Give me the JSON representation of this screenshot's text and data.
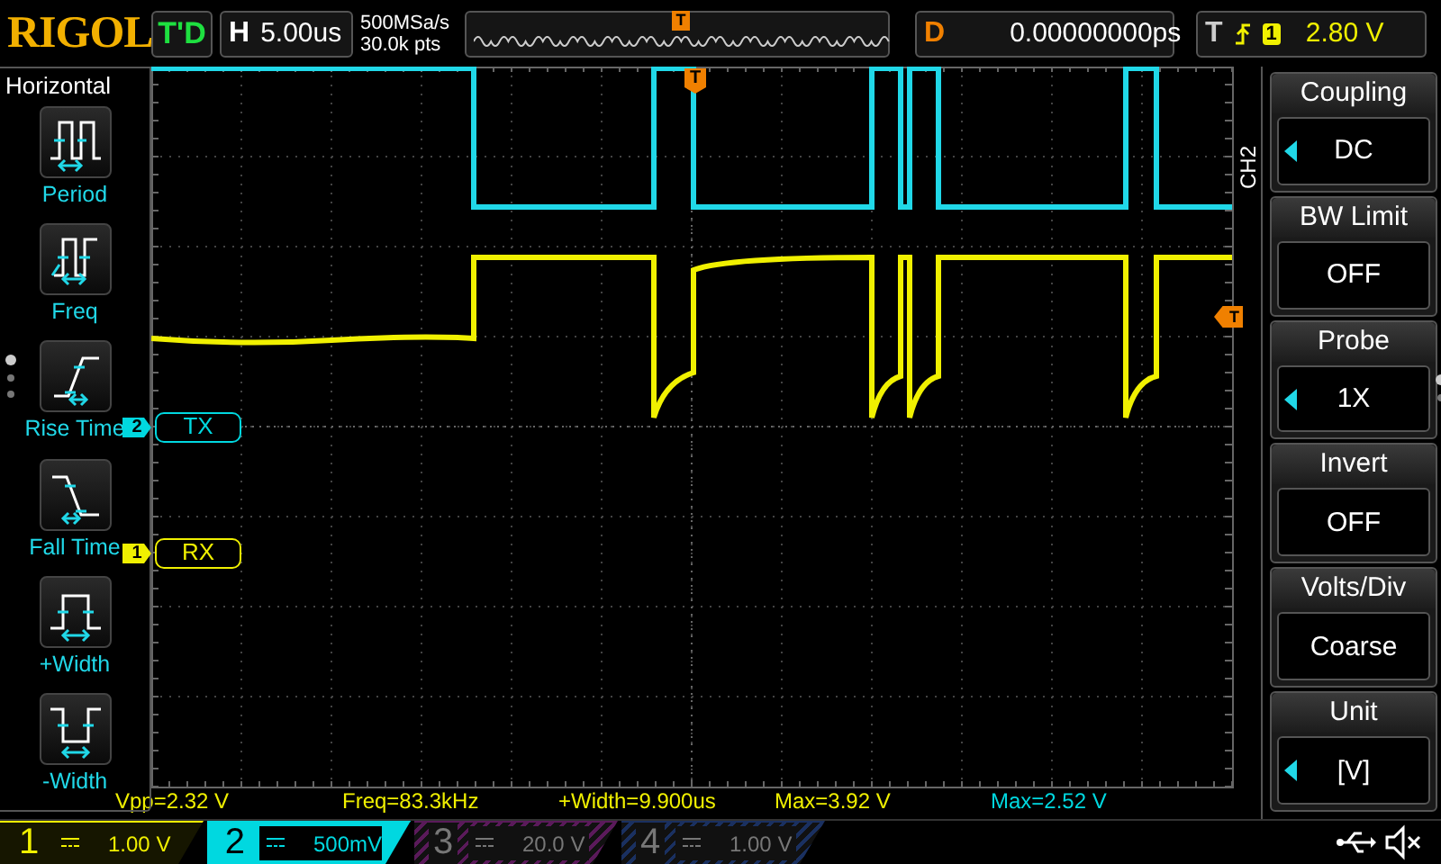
{
  "brand": "RIGOL",
  "run_status": "T'D",
  "horizontal": {
    "label": "H",
    "timebase": "5.00us",
    "sample_rate": "500MSa/s",
    "memory_depth": "30.0k pts"
  },
  "overview_marker": "T",
  "delay": {
    "label": "D",
    "value": "0.00000000ps"
  },
  "trigger": {
    "label": "T",
    "source": "1",
    "level": "2.80 V"
  },
  "left_menu": {
    "title": "Horizontal",
    "items": [
      {
        "label": "Period",
        "kind": "period"
      },
      {
        "label": "Freq",
        "kind": "freq"
      },
      {
        "label": "Rise Time",
        "kind": "rise"
      },
      {
        "label": "Fall Time",
        "kind": "fall"
      },
      {
        "label": "+Width",
        "kind": "pwidth"
      },
      {
        "label": "-Width",
        "kind": "nwidth"
      }
    ]
  },
  "trigger_position_marker": "T",
  "trigger_level_marker": "T",
  "channel_labels": [
    {
      "marker": "2",
      "text": "TX",
      "color": "#00d8e0"
    },
    {
      "marker": "1",
      "text": "RX",
      "color": "#f0f000"
    }
  ],
  "right_menu": {
    "channel": "CH2",
    "items": [
      {
        "title": "Coupling",
        "value": "DC",
        "adjustable": true
      },
      {
        "title": "BW Limit",
        "value": "OFF",
        "adjustable": false
      },
      {
        "title": "Probe",
        "value": "1X",
        "adjustable": true
      },
      {
        "title": "Invert",
        "value": "OFF",
        "adjustable": false
      },
      {
        "title": "Volts/Div",
        "value": "Coarse",
        "adjustable": false
      },
      {
        "title": "Unit",
        "value": "[V]",
        "adjustable": true
      }
    ]
  },
  "channels": [
    {
      "number": "1",
      "scale": "1.00 V",
      "on": true,
      "selected": false,
      "color": "#f0f000",
      "measurements": [
        "Vpp=2.32 V",
        "Freq=83.3kHz",
        "+Width=9.900us",
        "Max=3.92 V"
      ]
    },
    {
      "number": "2",
      "scale": "500mV",
      "on": true,
      "selected": true,
      "color": "#00d8e0",
      "measurements": [
        "Max=2.52 V"
      ]
    },
    {
      "number": "3",
      "scale": "20.0 V",
      "on": false,
      "selected": false,
      "color": "#5a1a5a"
    },
    {
      "number": "4",
      "scale": "1.00 V",
      "on": false,
      "selected": false,
      "color": "#1a3060"
    }
  ]
}
